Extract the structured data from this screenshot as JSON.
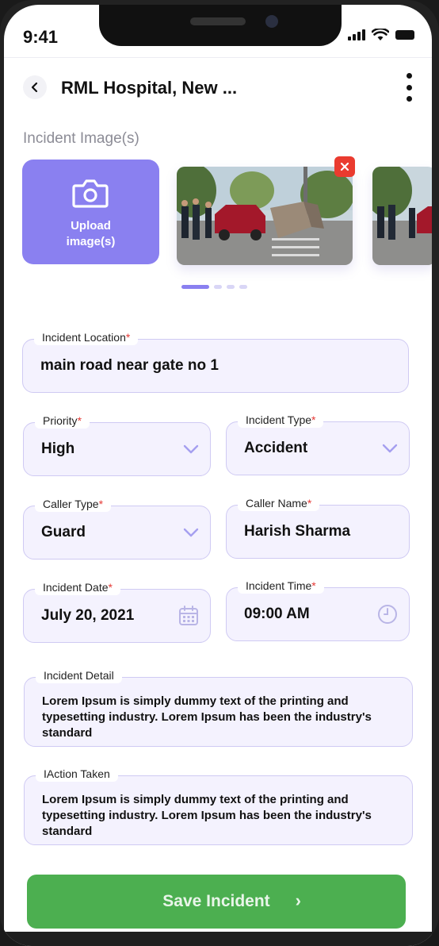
{
  "status_bar": {
    "time": "9:41"
  },
  "header": {
    "title": "RML Hospital, New ..."
  },
  "images": {
    "section_title": "Incident Image(s)",
    "upload_label_line1": "Upload",
    "upload_label_line2": "image(s)",
    "carousel_count": 4,
    "active_index": 0
  },
  "form": {
    "incident_location": {
      "label": "Incident Location",
      "required": "*",
      "value": "main road near gate no 1"
    },
    "priority": {
      "label": "Priority",
      "required": "*",
      "value": "High"
    },
    "incident_type": {
      "label": "Incident Type",
      "required": "*",
      "value": "Accident"
    },
    "caller_type": {
      "label": "Caller Type",
      "required": "*",
      "value": "Guard"
    },
    "caller_name": {
      "label": "Caller Name",
      "required": "*",
      "value": "Harish Sharma"
    },
    "incident_date": {
      "label": "Incident Date",
      "required": "*",
      "value": "July 20, 2021"
    },
    "incident_time": {
      "label": "Incident Time",
      "required": "*",
      "value": "09:00 AM"
    },
    "incident_detail": {
      "label": "Incident Detail",
      "value": "Lorem Ipsum is simply dummy text of the printing and typesetting industry. Lorem Ipsum has been the industry's standard"
    },
    "action_taken": {
      "label": "IAction Taken",
      "value": "Lorem Ipsum is simply dummy text of the printing and typesetting industry. Lorem Ipsum has been the industry's standard"
    }
  },
  "actions": {
    "save_label": "Save Incident"
  },
  "colors": {
    "accent": "#8a80f0",
    "field_bg": "#f4f2fe",
    "field_border": "#cfcaf3",
    "save": "#4caf50",
    "required": "#e53935",
    "remove": "#ea3b2f"
  }
}
